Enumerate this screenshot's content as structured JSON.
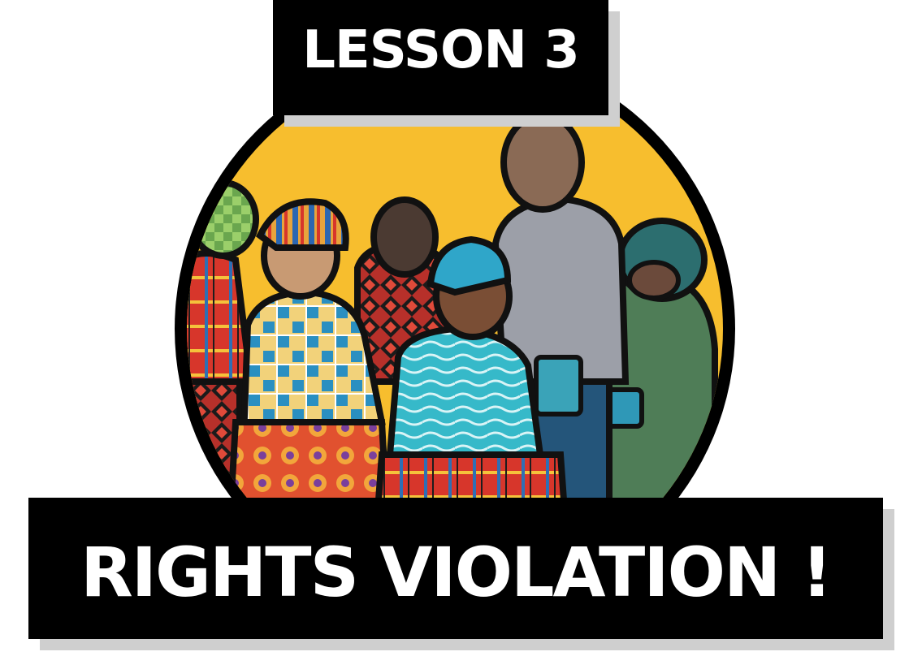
{
  "header": {
    "lesson_label": "LESSON 3"
  },
  "banner": {
    "title": "RIGHTS VIOLATION !"
  },
  "illustration": {
    "icon": "group-of-people-illustration",
    "colors": {
      "background_yellow": "#F7BE2E",
      "outline": "#111111",
      "skin_brown": "#7A4E35",
      "skin_dark": "#4B3A32",
      "shirt_grey": "#9C9FA8",
      "teal": "#2FA6C9",
      "green": "#4F7D57",
      "red": "#D7362B"
    }
  }
}
